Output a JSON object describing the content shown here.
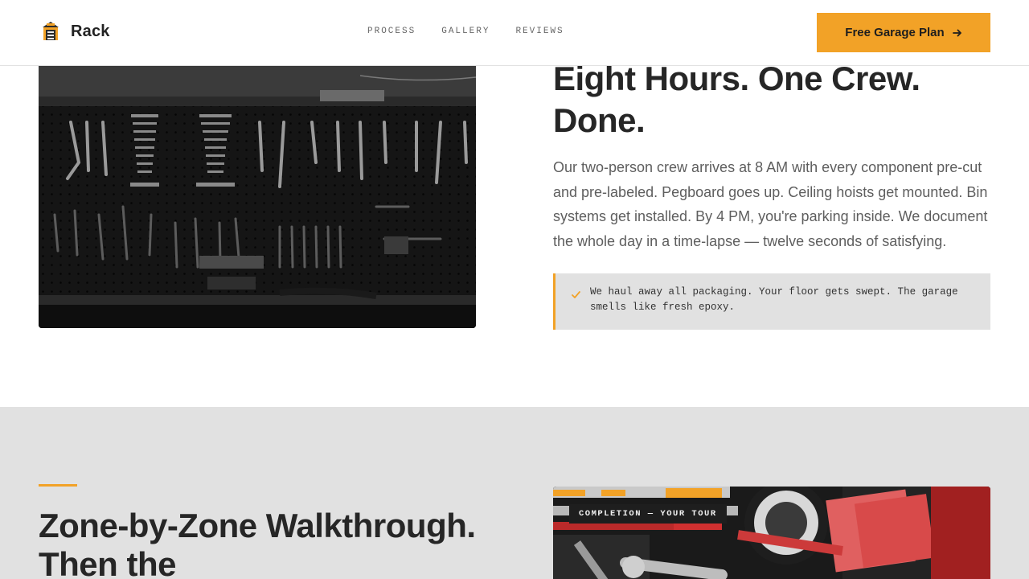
{
  "header": {
    "brand_name": "Rack",
    "brand_icon": "garage-house-icon",
    "nav": [
      {
        "label": "PROCESS"
      },
      {
        "label": "GALLERY"
      },
      {
        "label": "REVIEWS"
      }
    ],
    "cta_label": "Free Garage Plan",
    "cta_icon": "arrow-right-icon"
  },
  "install_section": {
    "heading": "Eight Hours. One Crew. Done.",
    "body": "Our two-person crew arrives at 8 AM with every component pre-cut and pre-labeled. Pegboard goes up. Ceiling hoists get mounted. Bin systems get installed. By 4 PM, you're parking inside. We document the whole day in a time-lapse — twelve seconds of satisfying.",
    "note_icon": "check-icon",
    "note": "We haul away all packaging. Your floor gets swept. The garage smells like fresh epoxy.",
    "image": "pegboard-tool-wall-photo"
  },
  "walkthrough_section": {
    "heading": "Zone-by-Zone Walkthrough. Then the",
    "photo_tag": "COMPLETION — YOUR TOUR",
    "image": "tool-drawer-closeup-photo"
  },
  "colors": {
    "accent": "#f2a227",
    "text_dark": "#262626",
    "text_muted": "#5e5e5e",
    "section_bg": "#e1e1e1"
  }
}
